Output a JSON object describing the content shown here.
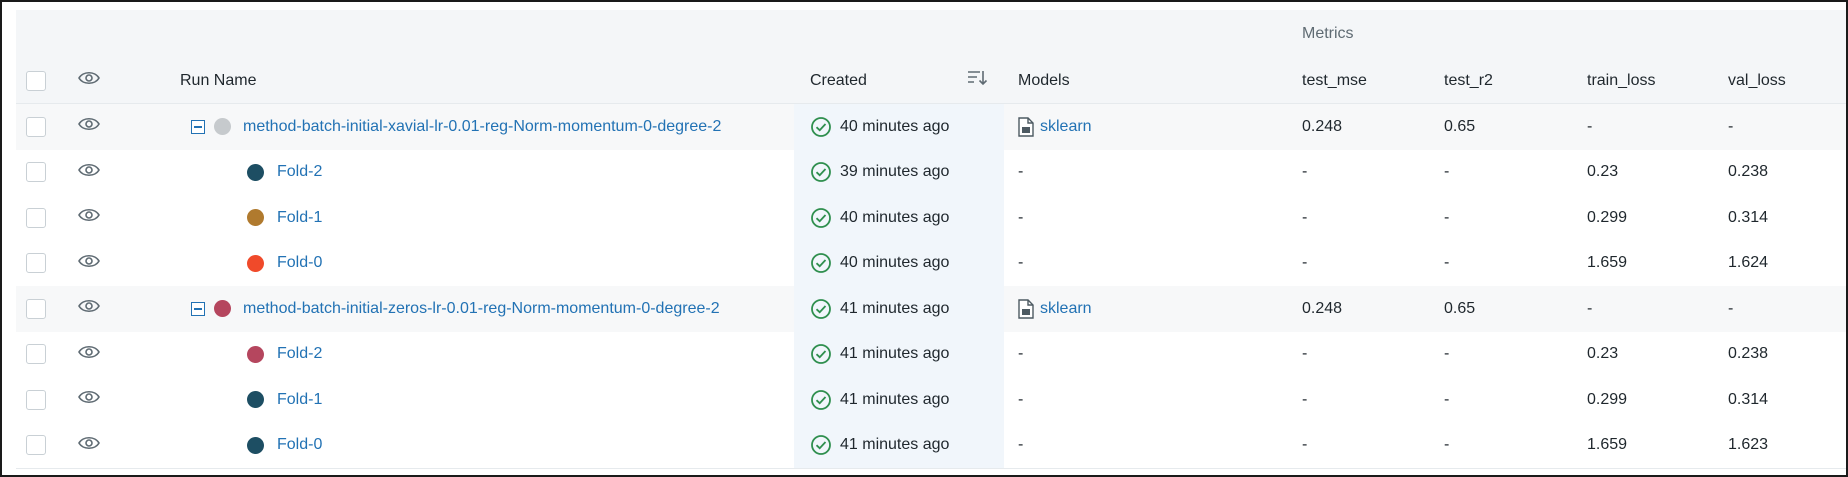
{
  "metrics_header": "Metrics",
  "columns": {
    "run_name": "Run Name",
    "created": "Created",
    "models": "Models",
    "test_mse": "test_mse",
    "test_r2": "test_r2",
    "train_loss": "train_loss",
    "val_loss": "val_loss"
  },
  "rows": [
    {
      "name": "method-batch-initial-xavial-lr-0.01-reg-Norm-momentum-0-degree-2",
      "created": "40 minutes ago",
      "models": "sklearn",
      "test_mse": "0.248",
      "test_r2": "0.65",
      "train_loss": "-",
      "val_loss": "-",
      "dot_color": "#c6cacd"
    },
    {
      "name": "Fold-2",
      "created": "39 minutes ago",
      "models": "-",
      "test_mse": "-",
      "test_r2": "-",
      "train_loss": "0.23",
      "val_loss": "0.238",
      "dot_color": "#1d4e63"
    },
    {
      "name": "Fold-1",
      "created": "40 minutes ago",
      "models": "-",
      "test_mse": "-",
      "test_r2": "-",
      "train_loss": "0.299",
      "val_loss": "0.314",
      "dot_color": "#b07a2e"
    },
    {
      "name": "Fold-0",
      "created": "40 minutes ago",
      "models": "-",
      "test_mse": "-",
      "test_r2": "-",
      "train_loss": "1.659",
      "val_loss": "1.624",
      "dot_color": "#f04a2a"
    },
    {
      "name": "method-batch-initial-zeros-lr-0.01-reg-Norm-momentum-0-degree-2",
      "created": "41 minutes ago",
      "models": "sklearn",
      "test_mse": "0.248",
      "test_r2": "0.65",
      "train_loss": "-",
      "val_loss": "-",
      "dot_color": "#b5465e"
    },
    {
      "name": "Fold-2",
      "created": "41 minutes ago",
      "models": "-",
      "test_mse": "-",
      "test_r2": "-",
      "train_loss": "0.23",
      "val_loss": "0.238",
      "dot_color": "#b5465e"
    },
    {
      "name": "Fold-1",
      "created": "41 minutes ago",
      "models": "-",
      "test_mse": "-",
      "test_r2": "-",
      "train_loss": "0.299",
      "val_loss": "0.314",
      "dot_color": "#1d4e63"
    },
    {
      "name": "Fold-0",
      "created": "41 minutes ago",
      "models": "-",
      "test_mse": "-",
      "test_r2": "-",
      "train_loss": "1.659",
      "val_loss": "1.623",
      "dot_color": "#1d4e63"
    }
  ]
}
